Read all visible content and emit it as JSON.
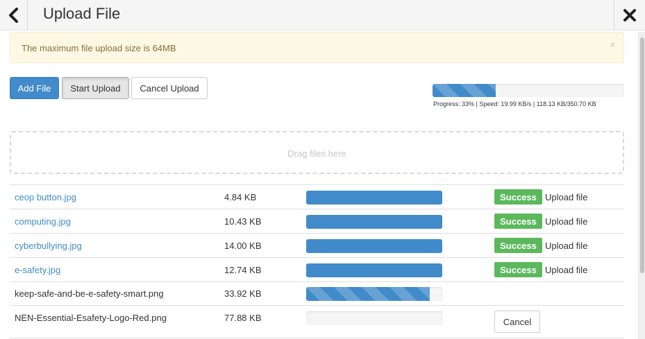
{
  "header": {
    "title": "Upload File",
    "back_icon": "chevron-left-icon",
    "close_icon": "close-icon"
  },
  "alert": {
    "text": "The maximum file upload size is 64MB",
    "close_glyph": "×"
  },
  "toolbar": {
    "add_label": "Add File",
    "start_label": "Start Upload",
    "cancel_label": "Cancel Upload"
  },
  "overall": {
    "percent": 33,
    "text": "Progress: 33% | Speed: 19.99 KB/s | 118.13 KB/350.70 KB"
  },
  "dropzone": {
    "text": "Drag files here"
  },
  "files": [
    {
      "name": "ceop button.jpg",
      "size": "4.84 KB",
      "percent": 100,
      "status": "Success",
      "action": "Upload file"
    },
    {
      "name": "computing.jpg",
      "size": "10.43 KB",
      "percent": 100,
      "status": "Success",
      "action": "Upload file"
    },
    {
      "name": "cyberbullying.jpg",
      "size": "14.00 KB",
      "percent": 100,
      "status": "Success",
      "action": "Upload file"
    },
    {
      "name": "e-safety.jpg",
      "size": "12.74 KB",
      "percent": 100,
      "status": "Success",
      "action": "Upload file"
    },
    {
      "name": "keep-safe-and-be-e-safety-smart.png",
      "size": "33.92 KB",
      "percent": 91
    },
    {
      "name": "NEN-Essential-Esafety-Logo-Red.png",
      "size": "77.88 KB",
      "percent": 0,
      "cancel_label": "Cancel"
    }
  ],
  "colors": {
    "primary": "#428bca",
    "success": "#5cb85c",
    "warning_bg": "#fcf8e3",
    "warning_text": "#8a6d3b"
  }
}
